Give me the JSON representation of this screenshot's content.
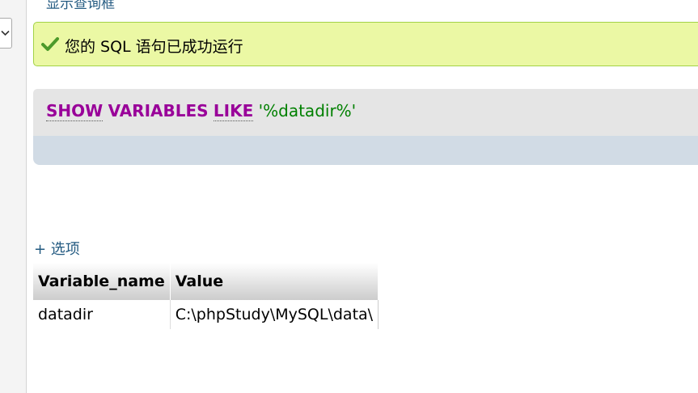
{
  "top_link": "显示查询框",
  "success": {
    "icon": "check-icon",
    "message": "您的 SQL 语句已成功运行"
  },
  "sql": {
    "kw_show": "SHOW",
    "kw_variables": "VARIABLES",
    "kw_like": "LIKE",
    "string": "'%datadir%'"
  },
  "options_link": "+ 选项",
  "table": {
    "headers": [
      "Variable_name",
      "Value"
    ],
    "rows": [
      [
        "datadir",
        "C:\\phpStudy\\MySQL\\data\\"
      ]
    ]
  },
  "colors": {
    "success_bg": "#ebf8a4",
    "success_border": "#a2d246",
    "keyword": "#990099",
    "string": "#008000",
    "link": "#235a81"
  }
}
